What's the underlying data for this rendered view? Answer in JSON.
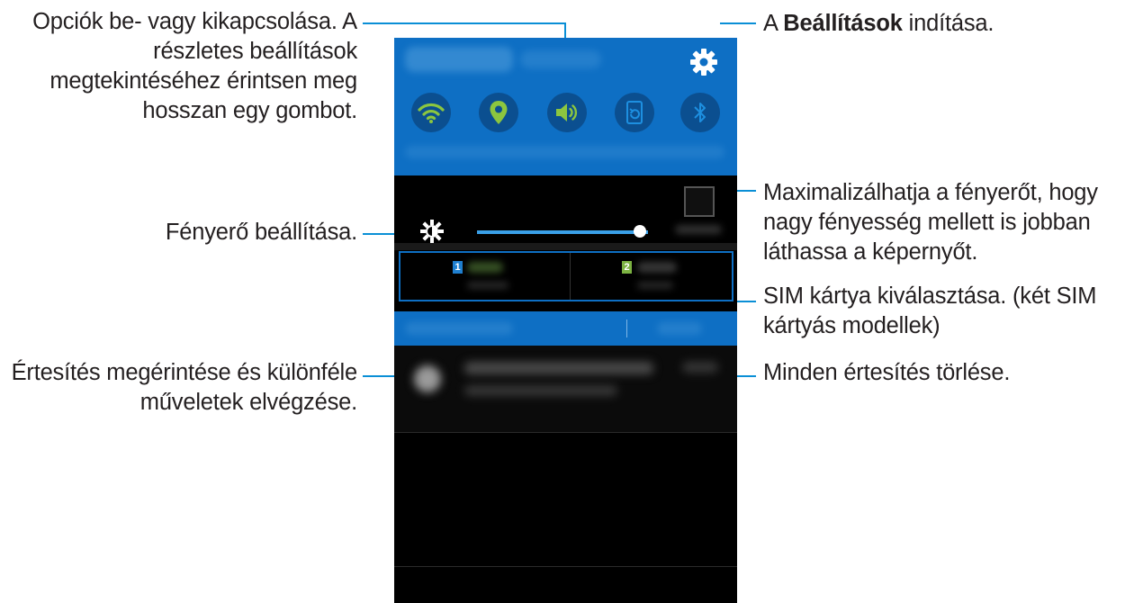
{
  "annotations": {
    "toggles": [
      "Opciók be- vagy kikapcsolása. A",
      "részletes beállítások",
      "megtekintéséhez érintsen meg",
      "hosszan egy gombot."
    ],
    "settings_prefix": "A ",
    "settings_bold": "Beállítások",
    "settings_suffix": " indítása.",
    "brightness": "Fényerő beállítása.",
    "max_brightness": [
      "Maximalizálhatja a fényerőt, hogy",
      "nagy fényesség mellett is jobban",
      "láthassa a képernyőt."
    ],
    "sim": [
      "SIM kártya kiválasztása. (két SIM",
      "kártyás modellek)"
    ],
    "notification": [
      "Értesítés megérintése és különféle",
      "műveletek elvégzése."
    ],
    "clear_all": "Minden értesítés törlése."
  },
  "phone": {
    "quick_settings": [
      "wifi-icon",
      "location-icon",
      "sound-icon",
      "screen-rotation-icon",
      "bluetooth-icon"
    ],
    "sim_cards": [
      "1",
      "2"
    ],
    "brightness_level": 0.95,
    "colors": {
      "panel_blue": "#0e6fc4",
      "toggle_on": "#8cc63f",
      "toggle_off": "#1d8fe0",
      "leader_line": "#0a8fd6",
      "sim1": "#1f7fcf",
      "sim2": "#7cb342"
    }
  }
}
